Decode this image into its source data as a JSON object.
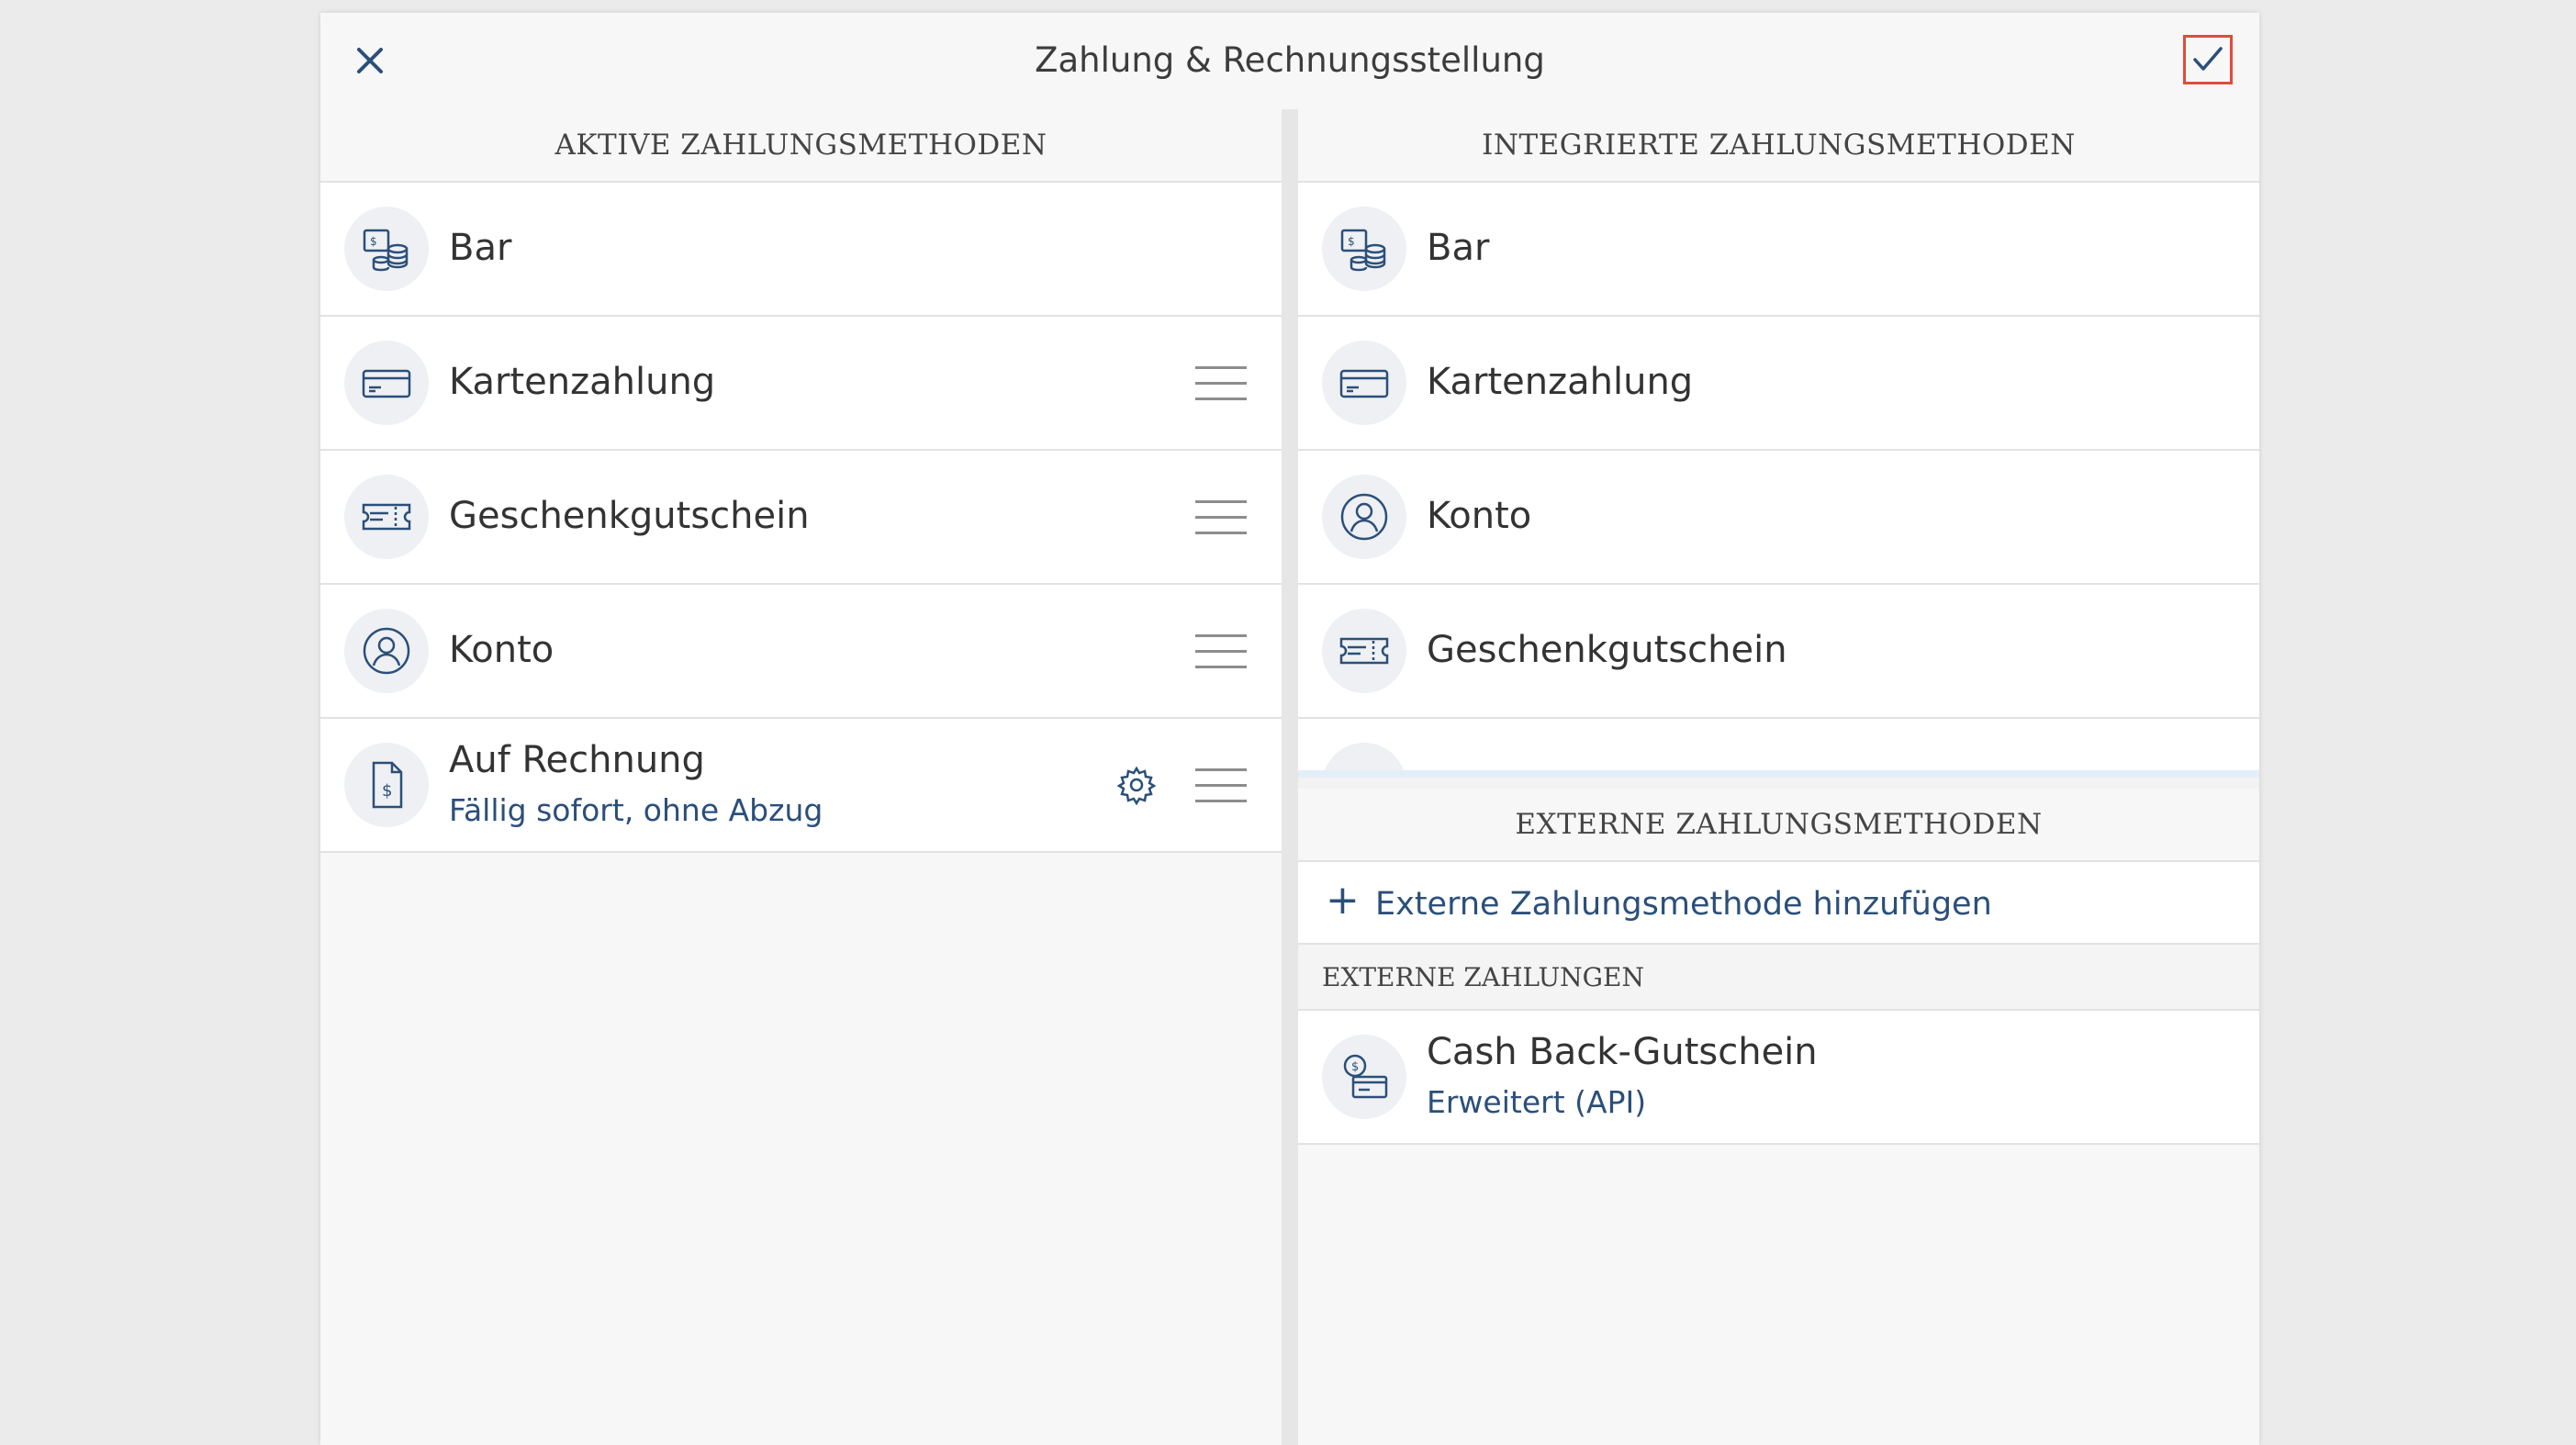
{
  "header": {
    "title": "Zahlung & Rechnungsstellung",
    "close_icon": "close-icon",
    "confirm_icon": "checkmark-icon",
    "confirm_highlight_color": "#e34a3a"
  },
  "active": {
    "heading": "AKTIVE ZAHLUNGSMETHODEN",
    "items": [
      {
        "label": "Bar",
        "icon": "cash-icon"
      },
      {
        "label": "Kartenzahlung",
        "icon": "card-icon"
      },
      {
        "label": "Geschenkgutschein",
        "icon": "voucher-icon"
      },
      {
        "label": "Konto",
        "icon": "account-icon"
      },
      {
        "label": "Auf Rechnung",
        "sublabel": "Fällig sofort, ohne Abzug",
        "icon": "invoice-icon"
      }
    ]
  },
  "integrated": {
    "heading": "INTEGRIERTE ZAHLUNGSMETHODEN",
    "items": [
      {
        "label": "Bar",
        "icon": "cash-icon"
      },
      {
        "label": "Kartenzahlung",
        "icon": "card-icon"
      },
      {
        "label": "Konto",
        "icon": "account-icon"
      },
      {
        "label": "Geschenkgutschein",
        "icon": "voucher-icon"
      }
    ]
  },
  "external": {
    "heading": "EXTERNE ZAHLUNGSMETHODEN",
    "add_label": "Externe Zahlungsmethode hinzufügen",
    "payments_heading": "EXTERNE ZAHLUNGEN",
    "items": [
      {
        "label": "Cash Back-Gutschein",
        "sublabel": "Erweitert (API)",
        "icon": "cashback-card-icon"
      }
    ]
  },
  "colors": {
    "accent": "#2b4f7a",
    "background": "#f7f7f7"
  }
}
